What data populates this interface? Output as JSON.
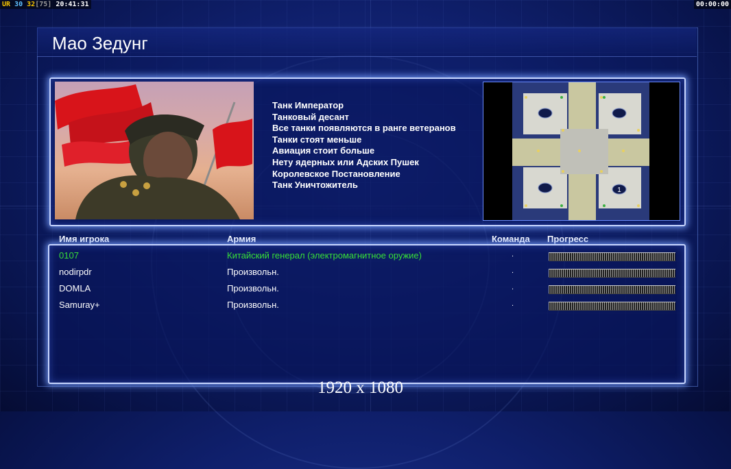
{
  "osd": {
    "ur": "UR",
    "v1": "30",
    "v2": "32",
    "v3": "[75]",
    "clock": "20:41:31",
    "timer": "00:00:00"
  },
  "general": {
    "name": "Мао Зедунг",
    "perks": [
      "Танк Император",
      "Танковый десант",
      "Все танки появляются в ранге ветеранов",
      "Танки стоят меньше",
      "Авиация стоит больше",
      "Нету ядерных или Адских Пушек",
      "Королевское Постановление",
      "Танк Уничтожитель"
    ]
  },
  "minimap": {
    "start_marker": "1"
  },
  "table": {
    "headers": {
      "player": "Имя игрока",
      "army": "Армия",
      "team": "Команда",
      "progress": "Прогресс"
    },
    "rows": [
      {
        "player": "0107",
        "army": "Китайский генерал (электромагнитное оружие)",
        "team": ".",
        "progress": 0,
        "highlight": true
      },
      {
        "player": "nodirpdr",
        "army": "Произвольн.",
        "team": ".",
        "progress": 0,
        "highlight": false
      },
      {
        "player": "DOMLA",
        "army": "Произвольн.",
        "team": ".",
        "progress": 0,
        "highlight": false
      },
      {
        "player": "Samuray+",
        "army": "Произвольн.",
        "team": ".",
        "progress": 0,
        "highlight": false
      }
    ]
  },
  "resolution": "1920 x 1080",
  "colors": {
    "highlight_text": "#38e038",
    "panel_border": "#c8d6ff",
    "background": "#0f1f6b"
  }
}
